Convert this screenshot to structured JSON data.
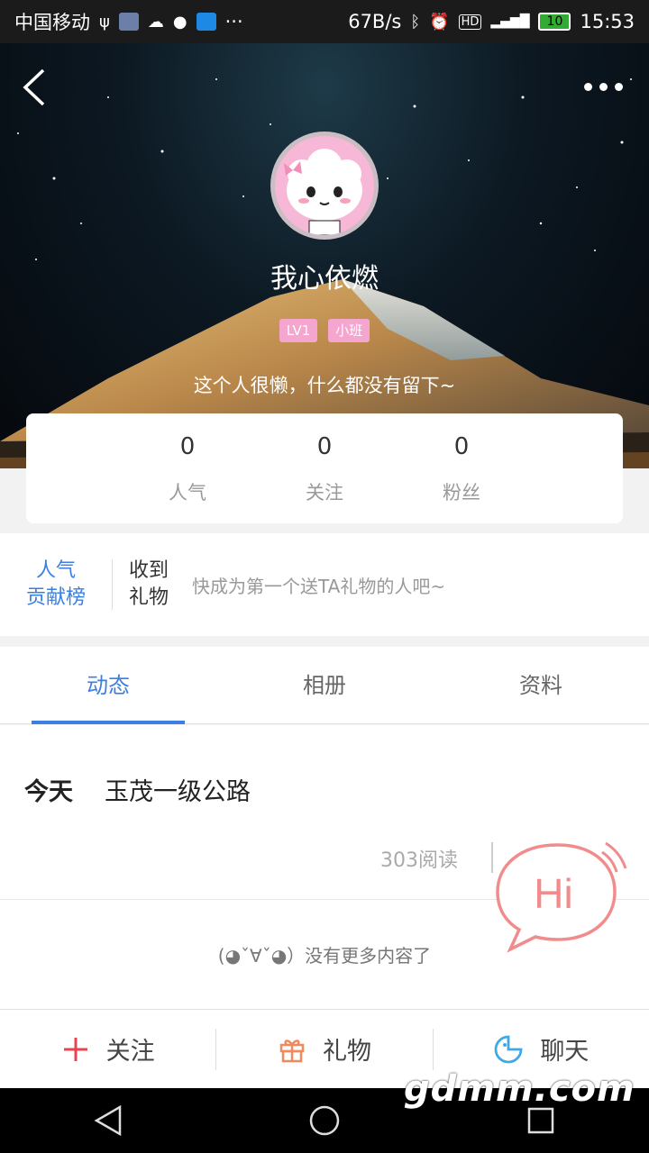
{
  "status_bar": {
    "carrier": "中国移动",
    "speed": "67B/s",
    "battery": "10",
    "time": "15:53"
  },
  "profile": {
    "username": "我心依燃",
    "badges": [
      "LV1",
      "小班"
    ],
    "bio": "这个人很懒，什么都没有留下~",
    "stats": [
      {
        "value": "0",
        "label": "人气"
      },
      {
        "value": "0",
        "label": "关注"
      },
      {
        "value": "0",
        "label": "粉丝"
      }
    ]
  },
  "gift": {
    "rank_line1": "人气",
    "rank_line2": "贡献榜",
    "received_line1": "收到",
    "received_line2": "礼物",
    "hint": "快成为第一个送TA礼物的人吧~"
  },
  "tabs": [
    {
      "label": "动态",
      "active": true
    },
    {
      "label": "相册",
      "active": false
    },
    {
      "label": "资料",
      "active": false
    }
  ],
  "feed": {
    "post": {
      "date": "今天",
      "title": "玉茂一级公路",
      "reads": "303阅读"
    },
    "end_text": "(◕ˇ∀ˇ◕）没有更多内容了"
  },
  "hi_bubble": {
    "text": "Hi"
  },
  "actions": [
    {
      "label": "关注",
      "icon": "plus-icon"
    },
    {
      "label": "礼物",
      "icon": "gift-icon"
    },
    {
      "label": "聊天",
      "icon": "chat-icon"
    }
  ],
  "watermark": "gdmm.com",
  "colors": {
    "accent": "#3b7fe0",
    "badge": "#f4a6cf",
    "follow_plus": "#e8434f",
    "gift": "#f08a5d",
    "chat": "#3fa9e6",
    "hi": "#f28b8b"
  }
}
